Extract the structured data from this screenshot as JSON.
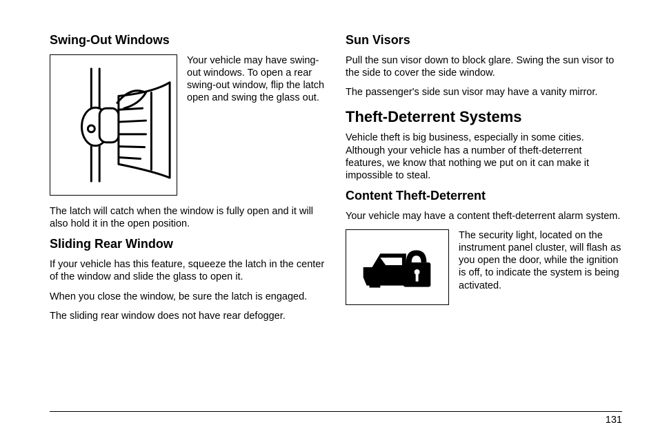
{
  "left": {
    "h_swing": "Swing-Out Windows",
    "swing_side": "Your vehicle may have swing-out windows. To open a rear swing-out window, flip the latch open and swing the glass out.",
    "swing_p2": "The latch will catch when the window is fully open and it will also hold it in the open position.",
    "h_sliding": "Sliding Rear Window",
    "sliding_p1": "If your vehicle has this feature, squeeze the latch in the center of the window and slide the glass to open it.",
    "sliding_p2": "When you close the window, be sure the latch is engaged.",
    "sliding_p3": "The sliding rear window does not have rear defogger."
  },
  "right": {
    "h_sun": "Sun Visors",
    "sun_p1": "Pull the sun visor down to block glare. Swing the sun visor to the side to cover the side window.",
    "sun_p2": "The passenger's side sun visor may have a vanity mirror.",
    "h_theft": "Theft-Deterrent Systems",
    "theft_p1": "Vehicle theft is big business, especially in some cities. Although your vehicle has a number of theft-deterrent features, we know that nothing we put on it can make it impossible to steal.",
    "h_content": "Content Theft-Deterrent",
    "content_p1": "Your vehicle may have a content theft-deterrent alarm system.",
    "content_side": "The security light, located on the instrument panel cluster, will flash as you open the door, while the ignition is off, to indicate the system is being activated."
  },
  "page_number": "131"
}
